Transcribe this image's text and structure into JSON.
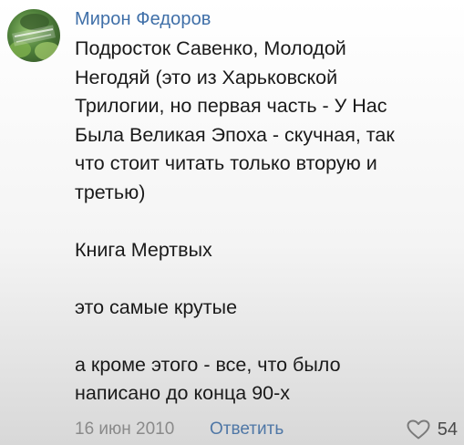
{
  "comment": {
    "author": "Мирон Федоров",
    "lines_block1": [
      "Подросток Савенко, Молодой",
      "Негодяй (это из Харьковской",
      "Трилогии, но первая часть - У Нас",
      "Была Великая Эпоха - скучная, так",
      "что стоит читать только вторую и",
      "третью)"
    ],
    "line_book": "Книга Мертвых",
    "line_best": "это самые крутые",
    "lines_block4": [
      "а кроме этого - все, что было",
      "написано до конца 90-х"
    ],
    "date": "16 июн 2010",
    "reply_label": "Ответить",
    "like_count": "54",
    "like_icon": "heart-outline-icon"
  },
  "colors": {
    "author": "#3f6fa8",
    "reply": "#4f77a6",
    "meta": "#8a8a8a",
    "text": "#1a1a1a"
  }
}
